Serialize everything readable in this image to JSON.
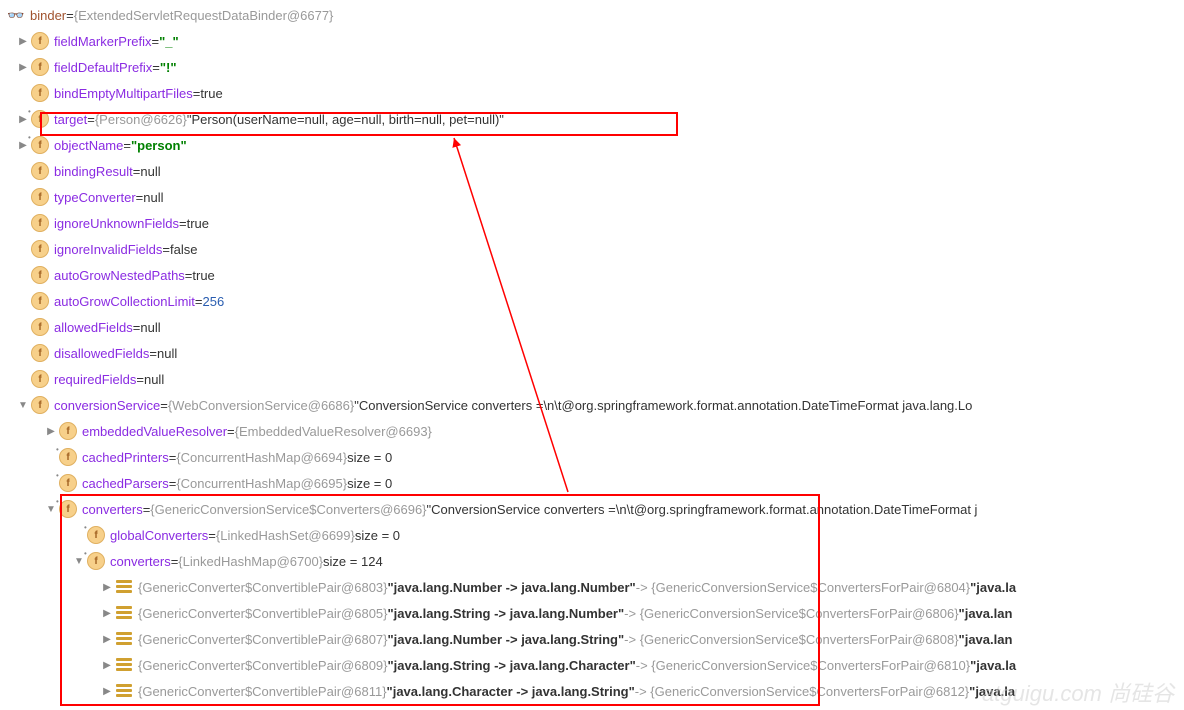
{
  "root": {
    "name": "binder",
    "obj": "{ExtendedServletRequestDataBinder@6677}"
  },
  "rows": [
    {
      "indent": 1,
      "expand": "right",
      "icon": "f",
      "name": "fieldMarkerPrefix",
      "value_parts": [
        {
          "t": "eq",
          "v": " = "
        },
        {
          "t": "green",
          "v": "\"_\""
        }
      ]
    },
    {
      "indent": 1,
      "expand": "right",
      "icon": "f",
      "name": "fieldDefaultPrefix",
      "value_parts": [
        {
          "t": "eq",
          "v": " = "
        },
        {
          "t": "green",
          "v": "\"!\""
        }
      ]
    },
    {
      "indent": 1,
      "expand": "none",
      "icon": "f",
      "name": "bindEmptyMultipartFiles",
      "value_parts": [
        {
          "t": "eq",
          "v": " = "
        },
        {
          "t": "bool",
          "v": "true"
        }
      ]
    },
    {
      "indent": 1,
      "expand": "right",
      "icon": "flock",
      "name": "target",
      "value_parts": [
        {
          "t": "eq",
          "v": " = "
        },
        {
          "t": "obj",
          "v": "{Person@6626} "
        },
        {
          "t": "str",
          "v": "\"Person(userName=null, age=null, birth=null, pet=null)\""
        }
      ],
      "boxed": true
    },
    {
      "indent": 1,
      "expand": "right",
      "icon": "flock",
      "name": "objectName",
      "value_parts": [
        {
          "t": "eq",
          "v": " = "
        },
        {
          "t": "green",
          "v": "\"person\""
        }
      ]
    },
    {
      "indent": 1,
      "expand": "none",
      "icon": "f",
      "name": "bindingResult",
      "value_parts": [
        {
          "t": "eq",
          "v": " = "
        },
        {
          "t": "null",
          "v": "null"
        }
      ]
    },
    {
      "indent": 1,
      "expand": "none",
      "icon": "f",
      "name": "typeConverter",
      "value_parts": [
        {
          "t": "eq",
          "v": " = "
        },
        {
          "t": "null",
          "v": "null"
        }
      ]
    },
    {
      "indent": 1,
      "expand": "none",
      "icon": "f",
      "name": "ignoreUnknownFields",
      "value_parts": [
        {
          "t": "eq",
          "v": " = "
        },
        {
          "t": "bool",
          "v": "true"
        }
      ]
    },
    {
      "indent": 1,
      "expand": "none",
      "icon": "f",
      "name": "ignoreInvalidFields",
      "value_parts": [
        {
          "t": "eq",
          "v": " = "
        },
        {
          "t": "bool",
          "v": "false"
        }
      ]
    },
    {
      "indent": 1,
      "expand": "none",
      "icon": "f",
      "name": "autoGrowNestedPaths",
      "value_parts": [
        {
          "t": "eq",
          "v": " = "
        },
        {
          "t": "bool",
          "v": "true"
        }
      ]
    },
    {
      "indent": 1,
      "expand": "none",
      "icon": "f",
      "name": "autoGrowCollectionLimit",
      "value_parts": [
        {
          "t": "eq",
          "v": " = "
        },
        {
          "t": "num",
          "v": "256"
        }
      ]
    },
    {
      "indent": 1,
      "expand": "none",
      "icon": "f",
      "name": "allowedFields",
      "value_parts": [
        {
          "t": "eq",
          "v": " = "
        },
        {
          "t": "null",
          "v": "null"
        }
      ]
    },
    {
      "indent": 1,
      "expand": "none",
      "icon": "f",
      "name": "disallowedFields",
      "value_parts": [
        {
          "t": "eq",
          "v": " = "
        },
        {
          "t": "null",
          "v": "null"
        }
      ]
    },
    {
      "indent": 1,
      "expand": "none",
      "icon": "f",
      "name": "requiredFields",
      "value_parts": [
        {
          "t": "eq",
          "v": " = "
        },
        {
          "t": "null",
          "v": "null"
        }
      ]
    },
    {
      "indent": 1,
      "expand": "down",
      "icon": "f",
      "name": "conversionService",
      "value_parts": [
        {
          "t": "eq",
          "v": " = "
        },
        {
          "t": "obj",
          "v": "{WebConversionService@6686} "
        },
        {
          "t": "str",
          "v": "\"ConversionService converters =\\n\\t@org.springframework.format.annotation.DateTimeFormat java.lang.Lo"
        }
      ]
    },
    {
      "indent": 2,
      "expand": "right",
      "icon": "f",
      "name": "embeddedValueResolver",
      "value_parts": [
        {
          "t": "eq",
          "v": " = "
        },
        {
          "t": "obj",
          "v": "{EmbeddedValueResolver@6693}"
        }
      ]
    },
    {
      "indent": 2,
      "expand": "none",
      "icon": "flock",
      "name": "cachedPrinters",
      "value_parts": [
        {
          "t": "eq",
          "v": " = "
        },
        {
          "t": "obj",
          "v": "{ConcurrentHashMap@6694}  "
        },
        {
          "t": "str",
          "v": "size = 0"
        }
      ]
    },
    {
      "indent": 2,
      "expand": "none",
      "icon": "flock",
      "name": "cachedParsers",
      "value_parts": [
        {
          "t": "eq",
          "v": " = "
        },
        {
          "t": "obj",
          "v": "{ConcurrentHashMap@6695}  "
        },
        {
          "t": "str",
          "v": "size = 0"
        }
      ]
    },
    {
      "indent": 2,
      "expand": "down",
      "icon": "flock",
      "name": "converters",
      "value_parts": [
        {
          "t": "eq",
          "v": " = "
        },
        {
          "t": "obj",
          "v": "{GenericConversionService$Converters@6696} "
        },
        {
          "t": "str",
          "v": "\"ConversionService converters =\\n\\t@org.springframework.format.annotation.DateTimeFormat j"
        }
      ]
    },
    {
      "indent": 3,
      "expand": "none",
      "icon": "flock",
      "name": "globalConverters",
      "value_parts": [
        {
          "t": "eq",
          "v": " = "
        },
        {
          "t": "obj",
          "v": "{LinkedHashSet@6699}  "
        },
        {
          "t": "str",
          "v": "size = 0"
        }
      ]
    },
    {
      "indent": 3,
      "expand": "down",
      "icon": "flock",
      "name": "converters",
      "value_parts": [
        {
          "t": "eq",
          "v": " = "
        },
        {
          "t": "obj",
          "v": "{LinkedHashMap@6700}  "
        },
        {
          "t": "str",
          "v": "size = 124"
        }
      ]
    },
    {
      "indent": 4,
      "expand": "right",
      "icon": "map",
      "raw": [
        {
          "t": "obj",
          "v": "{GenericConverter$ConvertiblePair@6803} "
        },
        {
          "t": "bold",
          "v": "\"java.lang.Number -> java.lang.Number\""
        },
        {
          "t": "obj",
          "v": " -> {GenericConversionService$ConvertersForPair@6804} "
        },
        {
          "t": "bold",
          "v": "\"java.la"
        }
      ]
    },
    {
      "indent": 4,
      "expand": "right",
      "icon": "map",
      "raw": [
        {
          "t": "obj",
          "v": "{GenericConverter$ConvertiblePair@6805} "
        },
        {
          "t": "bold",
          "v": "\"java.lang.String -> java.lang.Number\""
        },
        {
          "t": "obj",
          "v": " -> {GenericConversionService$ConvertersForPair@6806} "
        },
        {
          "t": "bold",
          "v": "\"java.lan"
        }
      ]
    },
    {
      "indent": 4,
      "expand": "right",
      "icon": "map",
      "raw": [
        {
          "t": "obj",
          "v": "{GenericConverter$ConvertiblePair@6807} "
        },
        {
          "t": "bold",
          "v": "\"java.lang.Number -> java.lang.String\""
        },
        {
          "t": "obj",
          "v": " -> {GenericConversionService$ConvertersForPair@6808} "
        },
        {
          "t": "bold",
          "v": "\"java.lan"
        }
      ]
    },
    {
      "indent": 4,
      "expand": "right",
      "icon": "map",
      "raw": [
        {
          "t": "obj",
          "v": "{GenericConverter$ConvertiblePair@6809} "
        },
        {
          "t": "bold",
          "v": "\"java.lang.String -> java.lang.Character\""
        },
        {
          "t": "obj",
          "v": " -> {GenericConversionService$ConvertersForPair@6810} "
        },
        {
          "t": "bold",
          "v": "\"java.la"
        }
      ]
    },
    {
      "indent": 4,
      "expand": "right",
      "icon": "map",
      "raw": [
        {
          "t": "obj",
          "v": "{GenericConverter$ConvertiblePair@6811} "
        },
        {
          "t": "bold",
          "v": "\"java.lang.Character -> java.lang.String\""
        },
        {
          "t": "obj",
          "v": " -> {GenericConversionService$ConvertersForPair@6812} "
        },
        {
          "t": "bold",
          "v": "\"java.la"
        }
      ]
    }
  ],
  "watermark": "atguigu.com 尚硅谷"
}
